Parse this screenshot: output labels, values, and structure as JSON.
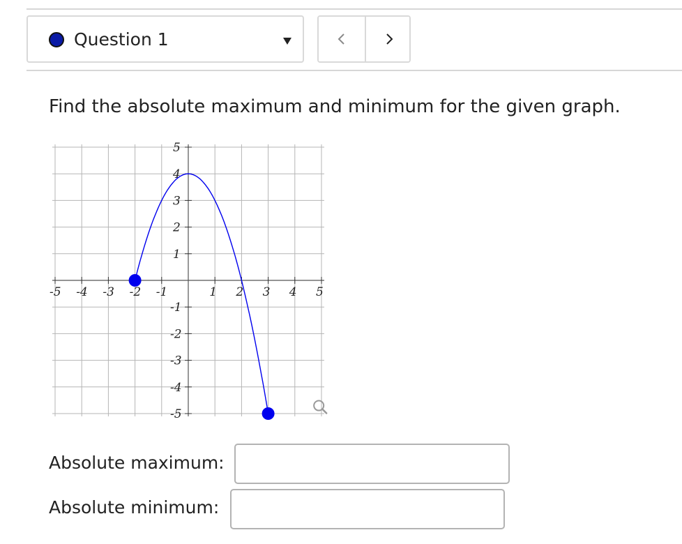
{
  "header": {
    "question_label": "Question 1",
    "status_color": "#0a1aa6",
    "dropdown_icon": "caret-down-icon",
    "prev_icon": "chevron-left-icon",
    "next_icon": "chevron-right-icon"
  },
  "prompt": {
    "text": "Find the absolute maximum and minimum for the given graph."
  },
  "graph": {
    "curve_color": "#0000ee",
    "point_color": "#0000ee",
    "zoom_icon": "magnifier-icon",
    "x_tick_labels": [
      "-5",
      "-4",
      "-3",
      "-2",
      "-1",
      "1",
      "2",
      "3",
      "4",
      "5"
    ],
    "y_tick_labels": [
      "5",
      "4",
      "3",
      "2",
      "1",
      "-1",
      "-2",
      "-3",
      "-4",
      "-5"
    ]
  },
  "chart_data": {
    "type": "line",
    "title": "",
    "xlabel": "",
    "ylabel": "",
    "xlim": [
      -5,
      5
    ],
    "ylim": [
      -5,
      5
    ],
    "grid": true,
    "series": [
      {
        "x": [
          -2,
          -1.5,
          -1,
          -0.5,
          0,
          0.5,
          1,
          1.5,
          2,
          2.5,
          3
        ],
        "y": [
          0,
          2.25,
          3.4,
          4.0,
          4.0,
          3.75,
          3.0,
          1.8,
          0,
          -2.6,
          -5
        ]
      }
    ],
    "endpoints": [
      {
        "x": -2,
        "y": 0
      },
      {
        "x": 3,
        "y": -5
      }
    ]
  },
  "answers": {
    "max_label": "Absolute maximum:",
    "min_label": "Absolute minimum:",
    "max_value": "",
    "min_value": ""
  }
}
